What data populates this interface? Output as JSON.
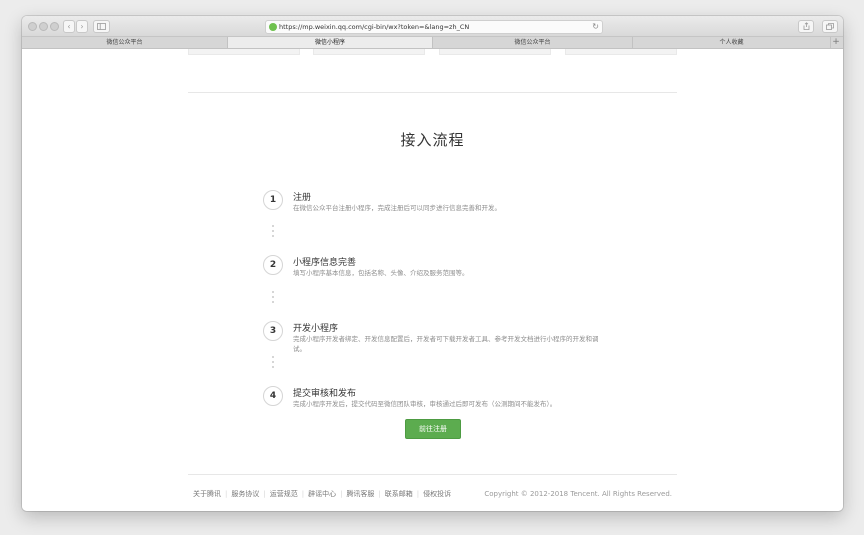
{
  "browser": {
    "url": "https://mp.weixin.qq.com/cgi-bin/wx?token=&lang=zh_CN",
    "tabs": [
      {
        "label": "微信公众平台",
        "active": false
      },
      {
        "label": "微信小程序",
        "active": true
      },
      {
        "label": "微信公众平台",
        "active": false
      },
      {
        "label": "个人收藏",
        "active": false
      }
    ],
    "add_tab_glyph": "+"
  },
  "main": {
    "title": "接入流程",
    "steps": [
      {
        "number": "1",
        "title": "注册",
        "desc": "在微信公众平台注册小程序，完成注册后可以同步进行信息完善和开发。"
      },
      {
        "number": "2",
        "title": "小程序信息完善",
        "desc": "填写小程序基本信息，包括名称、头像、介绍及服务范围等。"
      },
      {
        "number": "3",
        "title": "开发小程序",
        "desc": "完成小程序开发者绑定、开发信息配置后，开发者可下载开发者工具、参考开发文档进行小程序的开发和调试。"
      },
      {
        "number": "4",
        "title": "提交审核和发布",
        "desc": "完成小程序开发后，提交代码至微信团队审核，审核通过后即可发布（公测期间不能发布）。"
      }
    ],
    "register_button": "前往注册"
  },
  "footer": {
    "links": [
      "关于腾讯",
      "服务协议",
      "运营规范",
      "辟谣中心",
      "腾讯客服",
      "联系邮箱",
      "侵权投诉"
    ],
    "copyright": "Copyright © 2012-2018 Tencent. All Rights Reserved."
  },
  "colors": {
    "accent_green": "#5cac4f",
    "text_primary": "#353535",
    "text_secondary": "#8d8d8d"
  },
  "icons": [
    "close-dot-icon",
    "minimize-dot-icon",
    "zoom-dot-icon",
    "back-arrow-icon",
    "forward-arrow-icon",
    "sidebar-icon",
    "lock-icon",
    "reload-icon",
    "share-icon",
    "tabs-overview-icon"
  ]
}
